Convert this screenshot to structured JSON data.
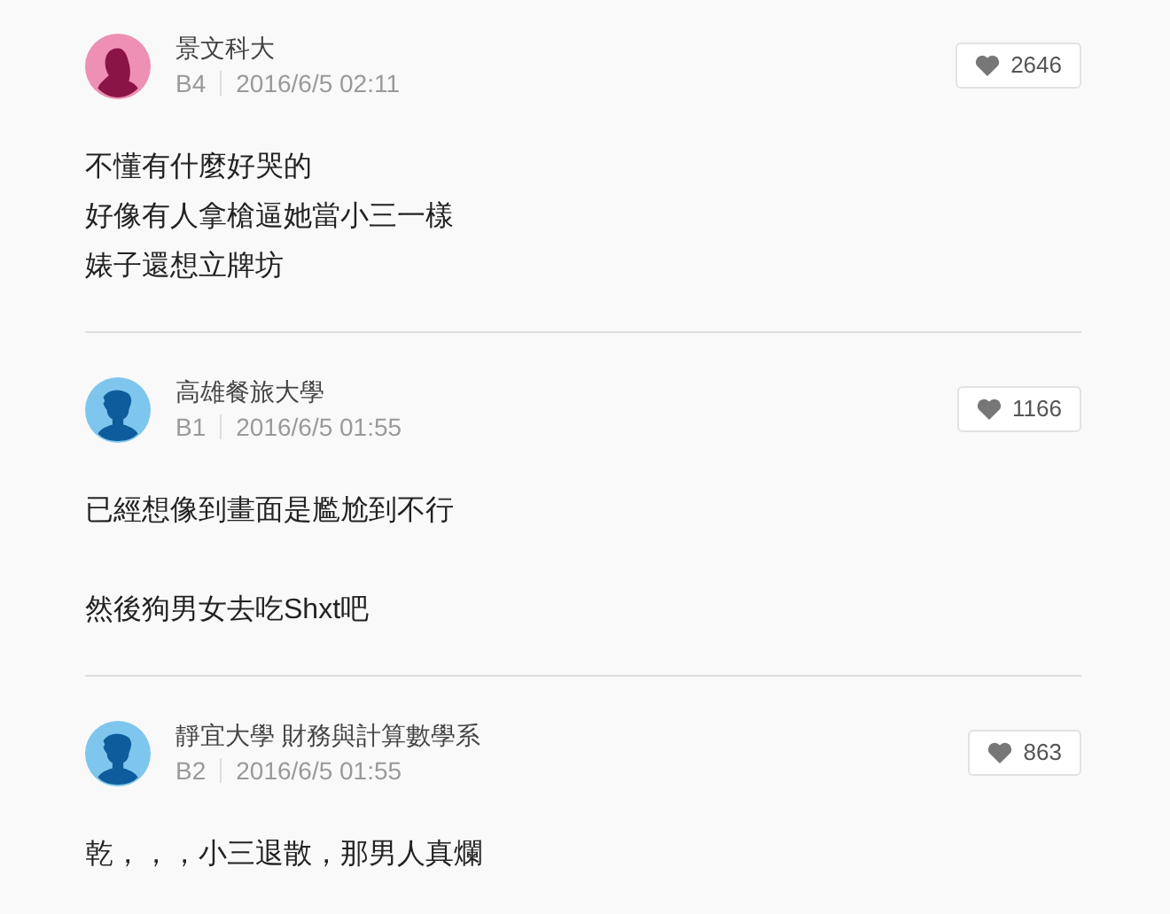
{
  "comments": [
    {
      "avatar": {
        "kind": "female"
      },
      "author": "景文科大",
      "floor": "B4",
      "time": "2016/6/5 02:11",
      "likes": "2646",
      "paragraphs": [
        [
          "不懂有什麼好哭的",
          "好像有人拿槍逼她當小三一樣",
          "婊子還想立牌坊"
        ]
      ]
    },
    {
      "avatar": {
        "kind": "male"
      },
      "author": "高雄餐旅大學",
      "floor": "B1",
      "time": "2016/6/5 01:55",
      "likes": "1166",
      "paragraphs": [
        [
          "已經想像到畫面是尷尬到不行"
        ],
        [
          "然後狗男女去吃Shxt吧"
        ]
      ]
    },
    {
      "avatar": {
        "kind": "male"
      },
      "author": "靜宜大學 財務與計算數學系",
      "floor": "B2",
      "time": "2016/6/5 01:55",
      "likes": "863",
      "paragraphs": [
        [
          "乾，，，小三退散，那男人真爛"
        ]
      ]
    }
  ]
}
